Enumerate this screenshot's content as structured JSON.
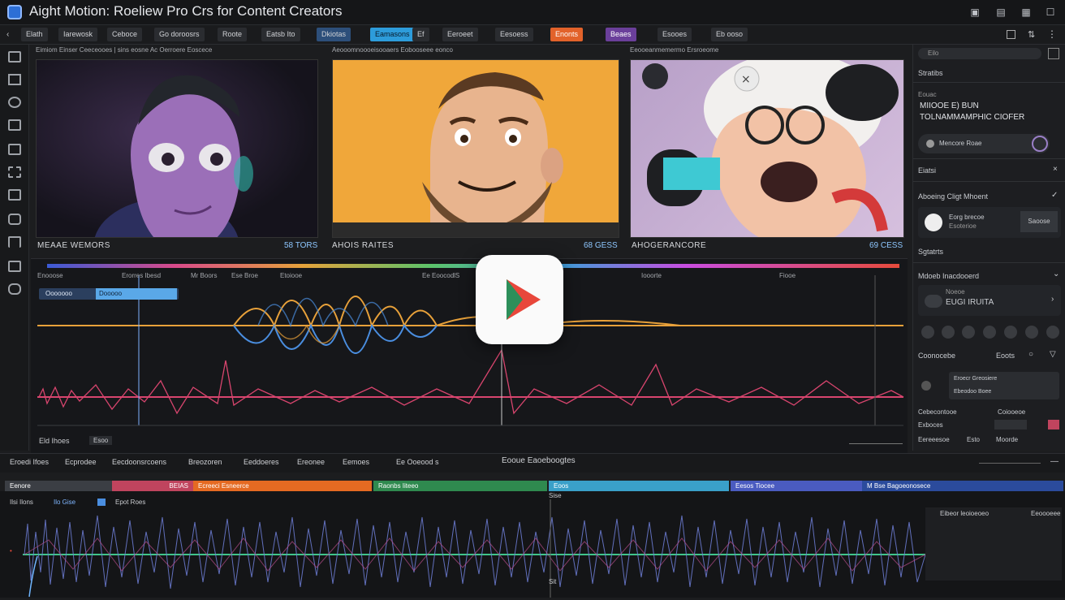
{
  "window": {
    "title": "Aight Motion: Roeliew Pro Crs for Content Creators"
  },
  "toolbar": [
    {
      "label": "Elath"
    },
    {
      "label": "Iarewosk"
    },
    {
      "label": "Ceboce"
    },
    {
      "label": "Go doroosrs"
    },
    {
      "label": "Roote"
    },
    {
      "label": "Eatsb Ito"
    },
    {
      "label": "Dkiotas"
    },
    {
      "label": "Eamasons"
    },
    {
      "label": "Ef"
    },
    {
      "label": "Eeroeet"
    },
    {
      "label": "Eesoess"
    },
    {
      "label": "Enonts"
    },
    {
      "label": "Beaes"
    },
    {
      "label": "Esooes"
    },
    {
      "label": "Eb ooso"
    }
  ],
  "previews": [
    {
      "header": "Eimiom Einser Ceeceooes | sins eosne Ac Oerroere Eoscece",
      "caption": "MEAAE WEMORS",
      "time": "58 TORS"
    },
    {
      "header": "Aeooomnoooeisooaers Eobooseee eonco",
      "caption": "AHOIS RAITES",
      "time": "68 GESS"
    },
    {
      "header": "Eeooeanmemermo Ersroeome",
      "caption": "AHOGERANCORE",
      "time": "69 CESS"
    }
  ],
  "timeline": {
    "labels": [
      "Enooose",
      "Erorres Ibesd",
      "Mr Boors",
      "Ese Broe",
      "Etoiooe",
      "Ee EoocodlS",
      "Iooorte",
      "Fiooe"
    ],
    "chip": {
      "name": "Ooooooo",
      "value": "Dooooo"
    },
    "footer_left": "Eld Ihoes",
    "footer_badge": "Esoo"
  },
  "right_panel": {
    "search_placeholder": "Eilo",
    "section1": "Stratibs",
    "label1": "Eouac",
    "heading_line1": "MIIOOE E) BUN",
    "heading_line2": "TOLNAMMAMPHIC CIOFER",
    "pill_text": "Mencore Roae",
    "section2": "Eiatsi",
    "section3": "Aboeing Cligt Mhoent",
    "card_line1": "Eorg brecoe",
    "card_line2": "Esoterioe",
    "card_button": "Saoose",
    "section4": "Sgtatrts",
    "section5": "Mdoeb Inacdooerd",
    "sub_small": "Noeoe",
    "sub_big": "EUGI IRUITA",
    "section6": "Coonocebe",
    "section6_right": "Eoots",
    "field1": "Eroecr Greosiere",
    "field2": "Ebeodoo Boee",
    "row1": "Cebecontooe",
    "row1_val": "Coiooeoe",
    "row2": "Exboces",
    "row3": "Eereeesoe",
    "row3b": "Esto",
    "row3c": "Moorde"
  },
  "bottom_tabs": [
    "Eroedi Ifoes",
    "Ecprodee",
    "Eecdoonsrcoens",
    "Breozoren",
    "Eeddoeres",
    "Ereonee",
    "Eemoes",
    "Ee Ooeood s",
    "Eooue Eaoeboogtes"
  ],
  "track_segments": [
    {
      "label": "Eenore",
      "color": "#3b3e44"
    },
    {
      "label": "BEIAS",
      "color": "#c0445e"
    },
    {
      "label": "Ecreeci Esneerce",
      "color": "#e56a22"
    },
    {
      "label": "Raonbs Iiteeo",
      "color": "#2f8a4f"
    },
    {
      "label": "Eoos",
      "color": "#3aa0c9"
    },
    {
      "label": "Eesos Tiocee",
      "color": "#4a5bc0"
    },
    {
      "label": "M Bse Bagoeonosece",
      "color": "#2b4b9c"
    }
  ],
  "bottom": {
    "left_label": "Ilsi Ilons",
    "left_value": "Ilo Gise",
    "mid_label": "Epot Roes",
    "panel_title": "Eibeor leoioeoeo",
    "panel_right": "Eeoooeee",
    "playhead_top": "Sise",
    "playhead_bottom": "Sit"
  },
  "colors": {
    "accent": "#2d9cdb",
    "wave_orange": "#e8a13a",
    "wave_blue": "#4a8ee0",
    "wave_pink": "#d8456e"
  }
}
